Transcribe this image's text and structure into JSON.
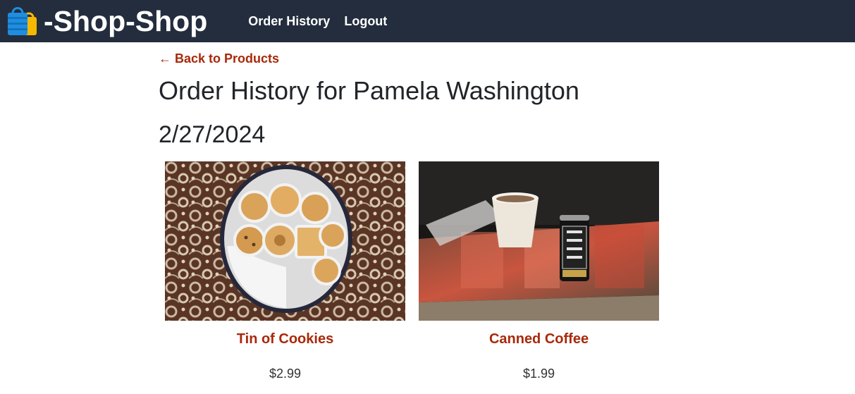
{
  "app": {
    "brand_text": "-Shop-Shop",
    "brand_icon": "shopping-bags-icon"
  },
  "nav": {
    "items": [
      {
        "label": "Order History"
      },
      {
        "label": "Logout"
      }
    ]
  },
  "main": {
    "back_link": "← Back to Products",
    "title": "Order History for Pamela Washington",
    "orders": [
      {
        "date": "2/27/2024",
        "products": [
          {
            "name": "Tin of Cookies",
            "price": "$2.99",
            "image_icon": "cookie-tin-photo"
          },
          {
            "name": "Canned Coffee",
            "price": "$1.99",
            "image_icon": "canned-coffee-photo"
          }
        ]
      }
    ]
  },
  "colors": {
    "header_bg": "#232d3d",
    "accent": "#a8290b",
    "text": "#212529"
  }
}
